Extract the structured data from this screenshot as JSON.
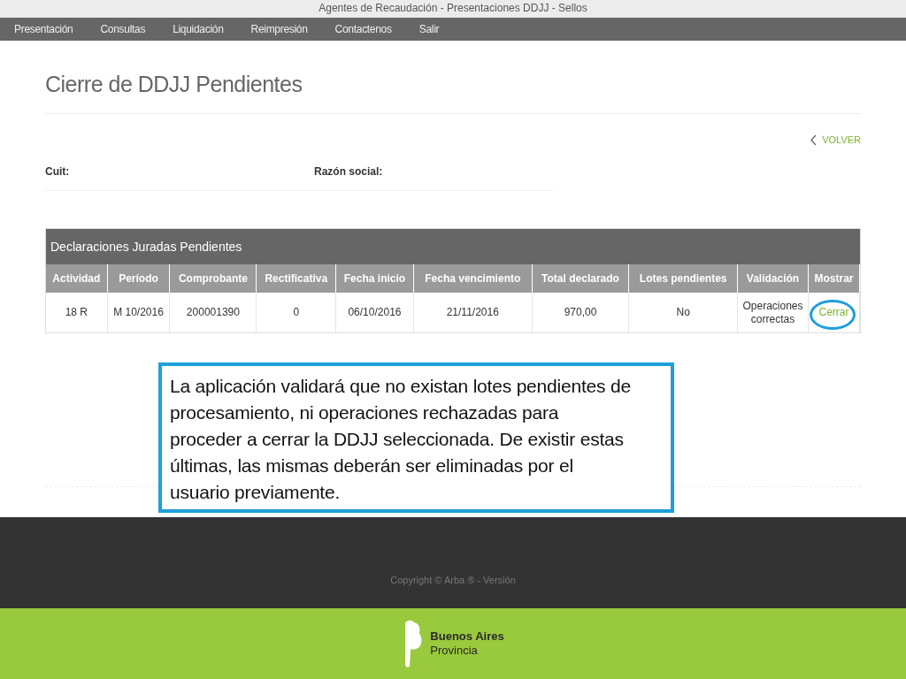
{
  "window": {
    "title": "Agentes de Recaudación - Presentaciones DDJJ - Sellos"
  },
  "nav": [
    {
      "label": "Presentación"
    },
    {
      "label": "Consultas"
    },
    {
      "label": "Liquidación"
    },
    {
      "label": "Reimpresión"
    },
    {
      "label": "Contactenos"
    },
    {
      "label": "Salir"
    }
  ],
  "page_title": "Cierre de DDJJ Pendientes",
  "back_link": "VOLVER",
  "fields": [
    {
      "label": "Cuit:"
    },
    {
      "label": "Razón social:"
    }
  ],
  "table": {
    "title": "Declaraciones Juradas Pendientes",
    "columns": [
      "Actividad",
      "Período",
      "Comprobante",
      "Rectificativa",
      "Fecha inicio",
      "Fecha vencimiento",
      "Total declarado",
      "Lotes pendientes",
      "Validación",
      "Mostrar"
    ],
    "rows": [
      {
        "cells": [
          "18 R",
          "M 10/2016",
          "200001390",
          "0",
          "06/10/2016",
          "21/11/2016",
          "970,00",
          "No",
          "Operaciones correctas"
        ],
        "action": "Cerrar",
        "highlighted": true
      }
    ]
  },
  "callout": "La aplicación validará que no existan lotes pendientes de procesamiento, ni operaciones rechazadas para proceder a cerrar la DDJJ seleccionada. De existir estas últimas, las mismas deberán ser eliminadas por el usuario previamente.",
  "footer": {
    "copyright": "Copyright © Arba ® - Versión",
    "logo_lines": [
      "Buenos Aires",
      "Provincia"
    ]
  }
}
